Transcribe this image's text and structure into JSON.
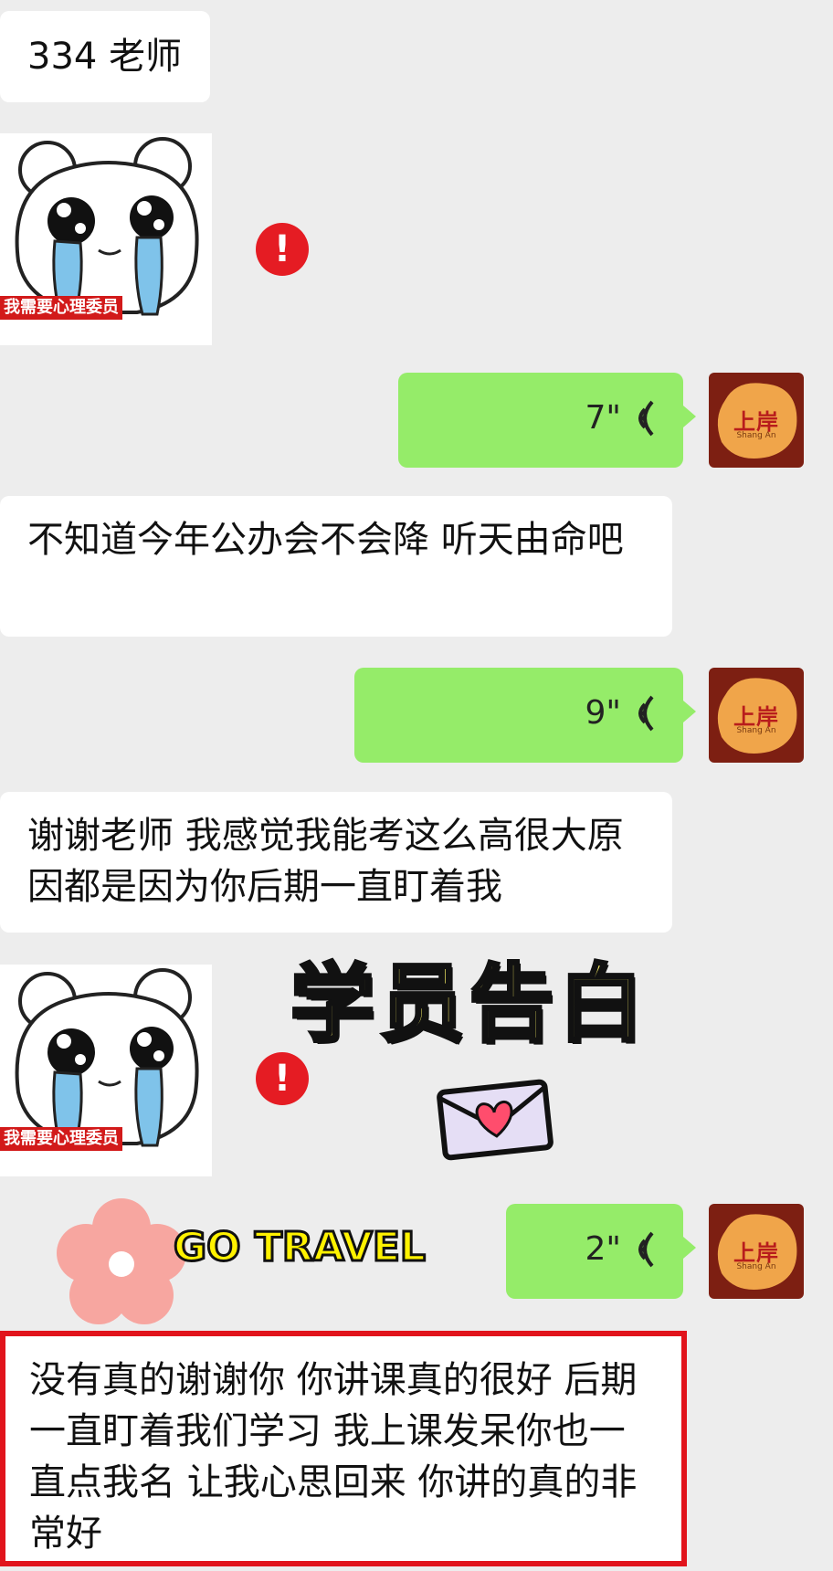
{
  "messages": {
    "m1_text": "334 老师",
    "sticker_caption": "我需要心理委员",
    "warn_symbol": "!",
    "voice1_duration": "7\"",
    "m2_text": "不知道今年公办会不会降 听天由命吧",
    "voice2_duration": "9\"",
    "m3_text": "谢谢老师 我感觉我能考这么高很大原因都是因为你后期一直盯着我",
    "voice3_duration": "2\"",
    "m4_text": "没有真的谢谢你 你讲课真的很好 后期一直盯着我们学习 我上课发呆你也一直点我名 让我心思回来 你讲的真的非常好"
  },
  "avatar": {
    "label": "上岸",
    "sub": "Shang An"
  },
  "overlay": {
    "headline": "学员告白",
    "tag": "GO TRAVEL"
  },
  "colors": {
    "background": "#ededed",
    "bubble_self": "#95ec69",
    "bubble_other": "#ffffff",
    "highlight_border": "#e1141c",
    "warning": "#e51c23"
  },
  "icons": [
    "crying-bear-sticker",
    "warning-icon",
    "voice-wave-icon",
    "love-letter-icon",
    "flower-icon"
  ]
}
